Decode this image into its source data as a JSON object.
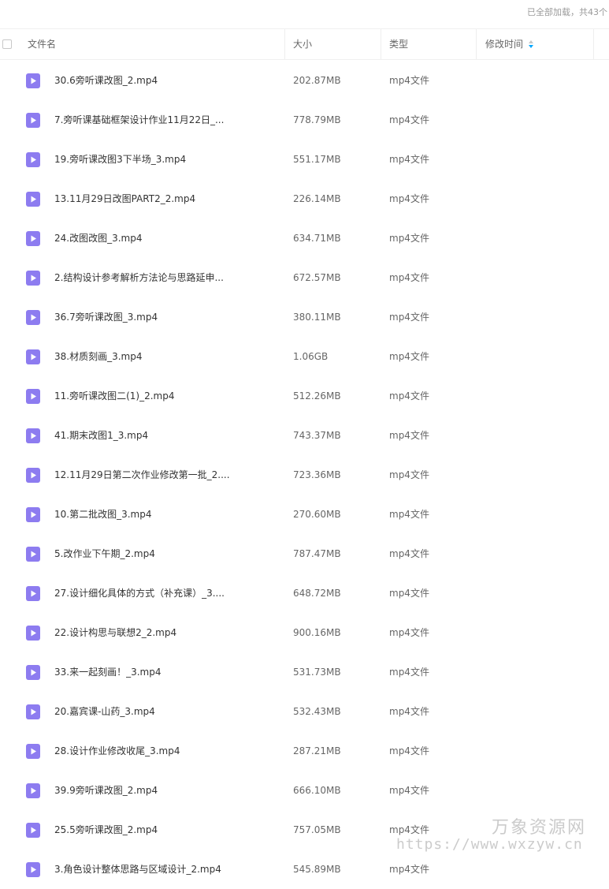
{
  "status_text": "已全部加载，共43个",
  "columns": {
    "name": "文件名",
    "size": "大小",
    "type": "类型",
    "mtime": "修改时间"
  },
  "colors": {
    "icon": "#8d7cf0",
    "accent": "#06a7ff"
  },
  "files": [
    {
      "name": "30.6旁听课改图_2.mp4",
      "size": "202.87MB",
      "type": "mp4文件"
    },
    {
      "name": "7.旁听课基础框架设计作业11月22日_...",
      "size": "778.79MB",
      "type": "mp4文件"
    },
    {
      "name": "19.旁听课改图3下半场_3.mp4",
      "size": "551.17MB",
      "type": "mp4文件"
    },
    {
      "name": "13.11月29日改图PART2_2.mp4",
      "size": "226.14MB",
      "type": "mp4文件"
    },
    {
      "name": "24.改图改图_3.mp4",
      "size": "634.71MB",
      "type": "mp4文件"
    },
    {
      "name": "2.结构设计参考解析方法论与思路延申...",
      "size": "672.57MB",
      "type": "mp4文件"
    },
    {
      "name": "36.7旁听课改图_3.mp4",
      "size": "380.11MB",
      "type": "mp4文件"
    },
    {
      "name": "38.材质刻画_3.mp4",
      "size": "1.06GB",
      "type": "mp4文件"
    },
    {
      "name": "11.旁听课改图二(1)_2.mp4",
      "size": "512.26MB",
      "type": "mp4文件"
    },
    {
      "name": "41.期末改图1_3.mp4",
      "size": "743.37MB",
      "type": "mp4文件"
    },
    {
      "name": "12.11月29日第二次作业修改第一批_2....",
      "size": "723.36MB",
      "type": "mp4文件"
    },
    {
      "name": "10.第二批改图_3.mp4",
      "size": "270.60MB",
      "type": "mp4文件"
    },
    {
      "name": "5.改作业下午期_2.mp4",
      "size": "787.47MB",
      "type": "mp4文件"
    },
    {
      "name": "27.设计细化具体的方式（补充课）_3....",
      "size": "648.72MB",
      "type": "mp4文件"
    },
    {
      "name": "22.设计构思与联想2_2.mp4",
      "size": "900.16MB",
      "type": "mp4文件"
    },
    {
      "name": "33.来一起刻画！_3.mp4",
      "size": "531.73MB",
      "type": "mp4文件"
    },
    {
      "name": "20.嘉宾课-山药_3.mp4",
      "size": "532.43MB",
      "type": "mp4文件"
    },
    {
      "name": "28.设计作业修改收尾_3.mp4",
      "size": "287.21MB",
      "type": "mp4文件"
    },
    {
      "name": "39.9旁听课改图_2.mp4",
      "size": "666.10MB",
      "type": "mp4文件"
    },
    {
      "name": "25.5旁听课改图_2.mp4",
      "size": "757.05MB",
      "type": "mp4文件"
    },
    {
      "name": "3.角色设计整体思路与区域设计_2.mp4",
      "size": "545.89MB",
      "type": "mp4文件"
    }
  ],
  "watermark": {
    "title": "万象资源网",
    "url": "https://www.wxzyw.cn"
  }
}
